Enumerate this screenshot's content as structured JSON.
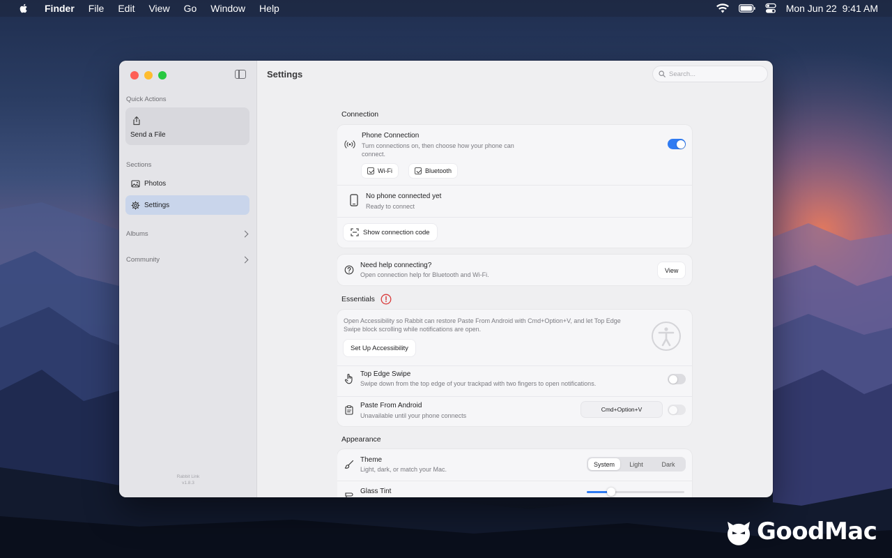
{
  "menubar": {
    "items": [
      "Finder",
      "File",
      "Edit",
      "View",
      "Go",
      "Window",
      "Help"
    ],
    "clock": "Mon Jun 22  9:41 AM"
  },
  "sidebar": {
    "quick_actions_heading": "Quick Actions",
    "send_file_label": "Send a File",
    "sections_heading": "Sections",
    "items": [
      {
        "label": "Photos",
        "icon": "photo-icon"
      },
      {
        "label": "Settings",
        "icon": "gear-icon",
        "active": true
      }
    ],
    "albums_label": "Albums",
    "community_label": "Community",
    "app_name": "Rabbit Link",
    "version": "v1.8.3"
  },
  "main": {
    "title": "Settings",
    "search_placeholder": "Search..."
  },
  "connection": {
    "heading": "Connection",
    "phone_title": "Phone Connection",
    "phone_sub": "Turn connections on, then choose how your phone can connect.",
    "phone_enabled": true,
    "options": [
      {
        "label": "Wi-Fi",
        "checked": true
      },
      {
        "label": "Bluetooth",
        "checked": true
      }
    ],
    "status_title": "No phone connected yet",
    "status_sub": "Ready to connect",
    "code_button": "Show connection code",
    "help_title": "Need help connecting?",
    "help_sub": "Open connection help for Bluetooth and Wi-Fi.",
    "help_button": "View"
  },
  "essentials": {
    "heading": "Essentials",
    "warning_icon": "exclamation-circle-icon",
    "note": "Open Accessibility so Rabbit can restore Paste From Android with Cmd+Option+V, and let Top Edge Swipe block scrolling while notifications are open.",
    "setup_button": "Set Up Accessibility",
    "swipe_title": "Top Edge Swipe",
    "swipe_sub": "Swipe down from the top edge of your trackpad with two fingers to open notifications.",
    "swipe_enabled": false,
    "paste_title": "Paste From Android",
    "paste_sub": "Unavailable until your phone connects",
    "paste_shortcut": "Cmd+Option+V",
    "paste_enabled": false
  },
  "appearance": {
    "heading": "Appearance",
    "theme_title": "Theme",
    "theme_sub": "Light, dark, or match your Mac.",
    "theme_options": [
      "System",
      "Light",
      "Dark"
    ],
    "theme_selected": "System",
    "tint_title": "Glass Tint",
    "tint_value": 0.25
  },
  "watermark": {
    "text": "GoodMac"
  },
  "colors": {
    "accent": "#2f7bf2",
    "warning": "#d93a3a"
  }
}
